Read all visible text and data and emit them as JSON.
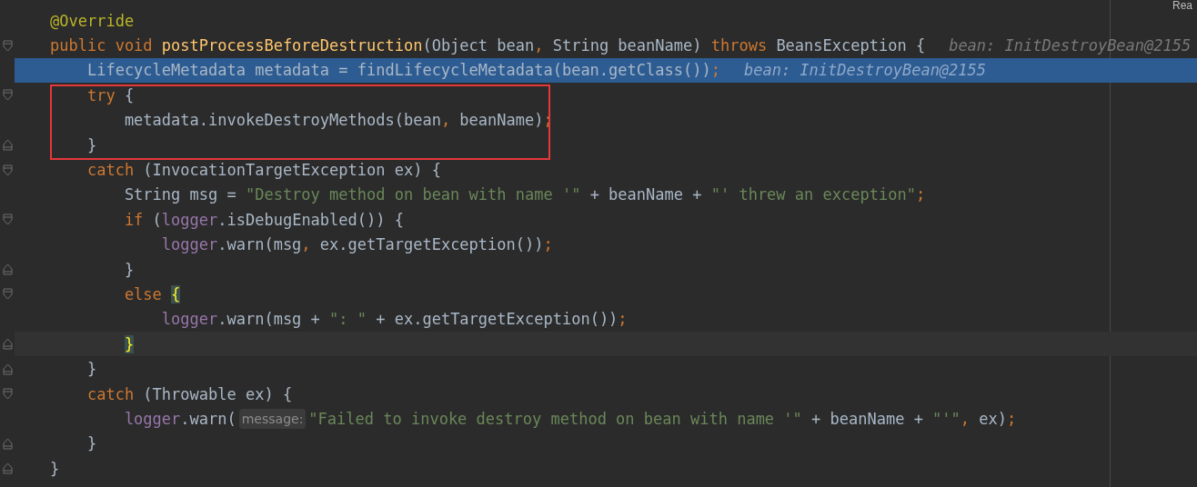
{
  "corner_label": "Rea",
  "lines": [
    {
      "fold_start": false,
      "fold_end": false,
      "execution_point": false,
      "caret_line": false,
      "boxed": false,
      "tokens": [
        {
          "kind": "annotation",
          "text": "@Override"
        }
      ]
    },
    {
      "fold_start": true,
      "fold_end": false,
      "execution_point": false,
      "caret_line": false,
      "boxed": false,
      "tokens": [
        {
          "kind": "keyword",
          "text": "public void "
        },
        {
          "kind": "method",
          "text": "postProcessBeforeDestruction"
        },
        {
          "kind": "plain",
          "text": "(Object bean"
        },
        {
          "kind": "punct",
          "text": ", "
        },
        {
          "kind": "plain",
          "text": "String beanName) "
        },
        {
          "kind": "keyword",
          "text": "throws "
        },
        {
          "kind": "plain",
          "text": "BeansException {"
        },
        {
          "kind": "debug_hint",
          "text": "bean: InitDestroyBean@2155"
        }
      ]
    },
    {
      "fold_start": false,
      "fold_end": false,
      "execution_point": true,
      "caret_line": false,
      "boxed": false,
      "tokens": [
        {
          "kind": "plain",
          "text": "    LifecycleMetadata metadata = findLifecycleMetadata(bean.getClass())"
        },
        {
          "kind": "punct",
          "text": ";"
        },
        {
          "kind": "debug_hint",
          "text": "bean: InitDestroyBean@2155"
        }
      ]
    },
    {
      "fold_start": true,
      "fold_end": false,
      "execution_point": false,
      "caret_line": false,
      "boxed": true,
      "tokens": [
        {
          "kind": "keyword",
          "text": "    try "
        },
        {
          "kind": "plain",
          "text": "{"
        }
      ]
    },
    {
      "fold_start": false,
      "fold_end": false,
      "execution_point": false,
      "caret_line": false,
      "boxed": true,
      "tokens": [
        {
          "kind": "plain",
          "text": "        metadata.invokeDestroyMethods(bean"
        },
        {
          "kind": "punct",
          "text": ", "
        },
        {
          "kind": "plain",
          "text": "beanName)"
        },
        {
          "kind": "punct",
          "text": ";"
        }
      ]
    },
    {
      "fold_start": false,
      "fold_end": true,
      "execution_point": false,
      "caret_line": false,
      "boxed": true,
      "tokens": [
        {
          "kind": "plain",
          "text": "    }"
        }
      ]
    },
    {
      "fold_start": true,
      "fold_end": false,
      "execution_point": false,
      "caret_line": false,
      "boxed": false,
      "tokens": [
        {
          "kind": "keyword",
          "text": "    catch "
        },
        {
          "kind": "plain",
          "text": "(InvocationTargetException ex) {"
        }
      ]
    },
    {
      "fold_start": false,
      "fold_end": false,
      "execution_point": false,
      "caret_line": false,
      "boxed": false,
      "tokens": [
        {
          "kind": "plain",
          "text": "        String msg = "
        },
        {
          "kind": "string",
          "text": "\"Destroy method on bean with name '\""
        },
        {
          "kind": "plain",
          "text": " + beanName + "
        },
        {
          "kind": "string",
          "text": "\"' threw an exception\""
        },
        {
          "kind": "punct",
          "text": ";"
        }
      ]
    },
    {
      "fold_start": true,
      "fold_end": false,
      "execution_point": false,
      "caret_line": false,
      "boxed": false,
      "tokens": [
        {
          "kind": "keyword",
          "text": "        if "
        },
        {
          "kind": "plain",
          "text": "("
        },
        {
          "kind": "field",
          "text": "logger"
        },
        {
          "kind": "plain",
          "text": ".isDebugEnabled()) {"
        }
      ]
    },
    {
      "fold_start": false,
      "fold_end": false,
      "execution_point": false,
      "caret_line": false,
      "boxed": false,
      "tokens": [
        {
          "kind": "field",
          "text": "            logger"
        },
        {
          "kind": "plain",
          "text": ".warn(msg"
        },
        {
          "kind": "punct",
          "text": ", "
        },
        {
          "kind": "plain",
          "text": "ex.getTargetException())"
        },
        {
          "kind": "punct",
          "text": ";"
        }
      ]
    },
    {
      "fold_start": false,
      "fold_end": true,
      "execution_point": false,
      "caret_line": false,
      "boxed": false,
      "tokens": [
        {
          "kind": "plain",
          "text": "        }"
        }
      ]
    },
    {
      "fold_start": true,
      "fold_end": false,
      "execution_point": false,
      "caret_line": false,
      "boxed": false,
      "tokens": [
        {
          "kind": "keyword",
          "text": "        else "
        },
        {
          "kind": "brace_match",
          "text": "{"
        }
      ]
    },
    {
      "fold_start": false,
      "fold_end": false,
      "execution_point": false,
      "caret_line": false,
      "boxed": false,
      "tokens": [
        {
          "kind": "field",
          "text": "            logger"
        },
        {
          "kind": "plain",
          "text": ".warn(msg + "
        },
        {
          "kind": "string",
          "text": "\": \""
        },
        {
          "kind": "plain",
          "text": " + ex.getTargetException())"
        },
        {
          "kind": "punct",
          "text": ";"
        }
      ]
    },
    {
      "fold_start": false,
      "fold_end": true,
      "execution_point": false,
      "caret_line": true,
      "boxed": false,
      "tokens": [
        {
          "kind": "brace_match",
          "text": "        }"
        }
      ]
    },
    {
      "fold_start": false,
      "fold_end": true,
      "execution_point": false,
      "caret_line": false,
      "boxed": false,
      "tokens": [
        {
          "kind": "plain",
          "text": "    }"
        }
      ]
    },
    {
      "fold_start": true,
      "fold_end": false,
      "execution_point": false,
      "caret_line": false,
      "boxed": false,
      "tokens": [
        {
          "kind": "keyword",
          "text": "    catch "
        },
        {
          "kind": "plain",
          "text": "(Throwable ex) {"
        }
      ]
    },
    {
      "fold_start": false,
      "fold_end": false,
      "execution_point": false,
      "caret_line": false,
      "boxed": false,
      "tokens": [
        {
          "kind": "field",
          "text": "        logger"
        },
        {
          "kind": "plain",
          "text": ".warn("
        },
        {
          "kind": "inlay",
          "text": "message:"
        },
        {
          "kind": "string",
          "text": "\"Failed to invoke destroy method on bean with name '\""
        },
        {
          "kind": "plain",
          "text": " + beanName + "
        },
        {
          "kind": "string",
          "text": "\"'\""
        },
        {
          "kind": "punct",
          "text": ", "
        },
        {
          "kind": "plain",
          "text": "ex)"
        },
        {
          "kind": "punct",
          "text": ";"
        }
      ]
    },
    {
      "fold_start": false,
      "fold_end": true,
      "execution_point": false,
      "caret_line": false,
      "boxed": false,
      "tokens": [
        {
          "kind": "plain",
          "text": "    }"
        }
      ]
    },
    {
      "fold_start": false,
      "fold_end": true,
      "execution_point": false,
      "caret_line": false,
      "boxed": false,
      "tokens": [
        {
          "kind": "plain",
          "text": "}"
        }
      ]
    }
  ]
}
